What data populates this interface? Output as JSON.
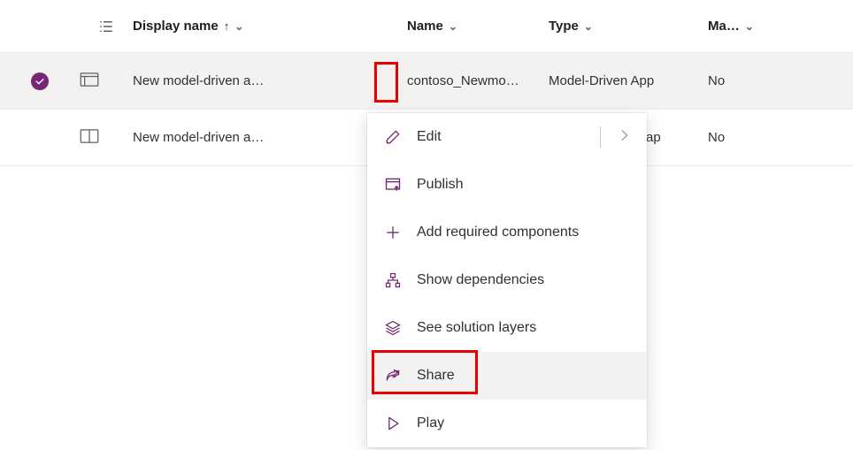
{
  "columns": {
    "display_name": "Display name",
    "name": "Name",
    "type": "Type",
    "managed": "Ma…"
  },
  "rows": [
    {
      "selected": true,
      "display_name": "New model-driven a…",
      "name": "contoso_Newmo…",
      "type": "Model-Driven App",
      "managed": "No"
    },
    {
      "selected": false,
      "display_name": "New model-driven a…",
      "name": "",
      "type_suffix": "ap",
      "managed": "No"
    }
  ],
  "menu": {
    "edit": "Edit",
    "publish": "Publish",
    "add_required": "Add required components",
    "show_deps": "Show dependencies",
    "solution_layers": "See solution layers",
    "share": "Share",
    "play": "Play"
  }
}
